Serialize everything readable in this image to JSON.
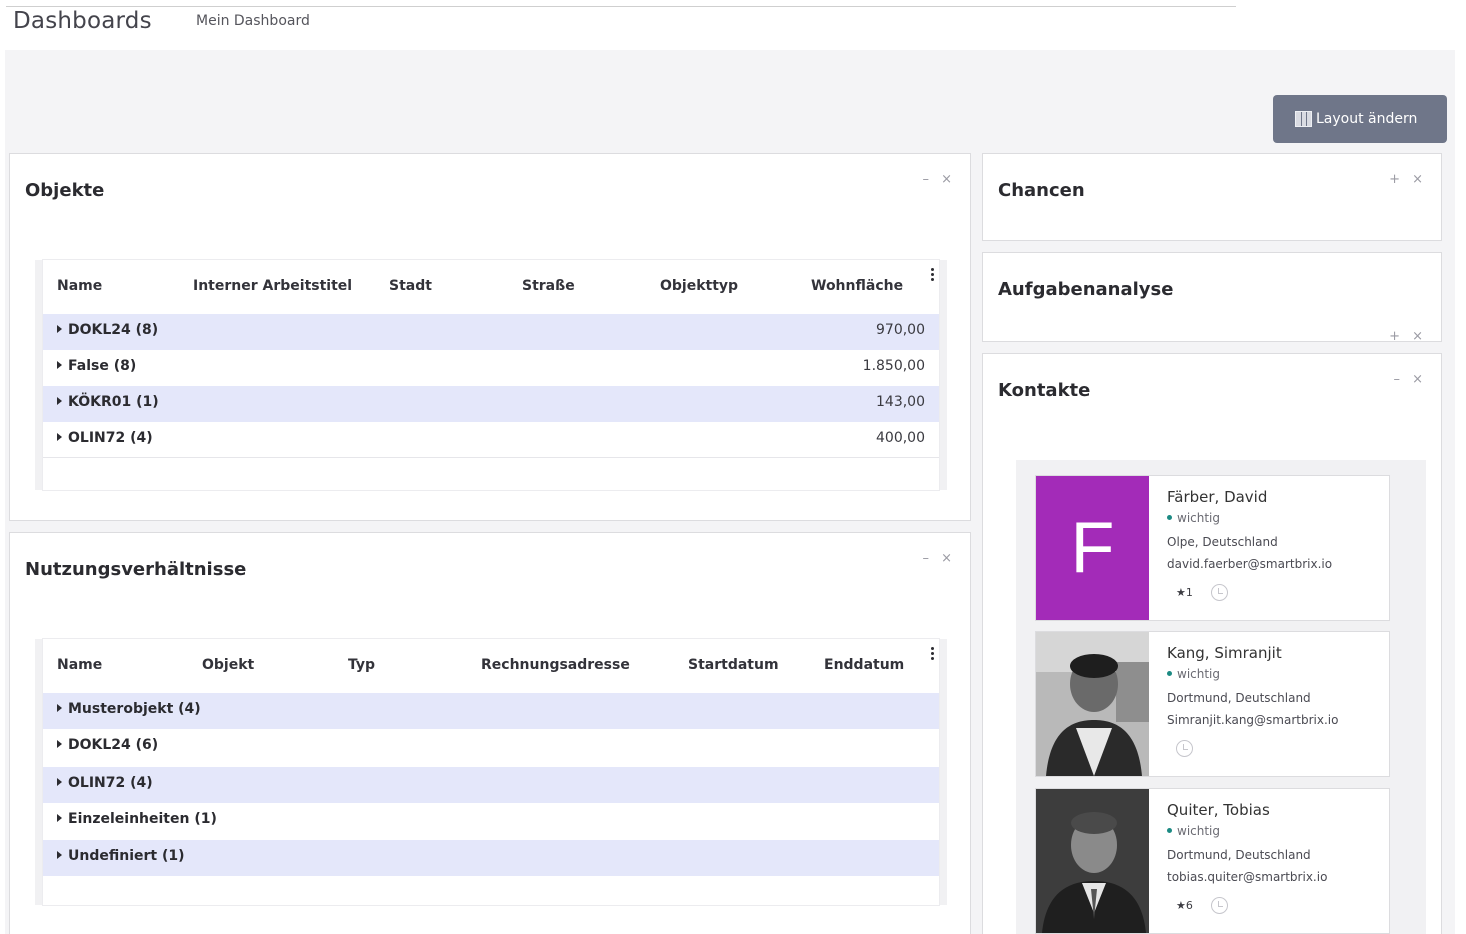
{
  "header": {
    "title": "Dashboards",
    "breadcrumb": "Mein Dashboard"
  },
  "toolbar": {
    "layout_button": "Layout ändern"
  },
  "objekte": {
    "title": "Objekte",
    "controls": "– ×",
    "columns": [
      "Name",
      "Interner Arbeitstitel",
      "Stadt",
      "Straße",
      "Objekttyp",
      "Wohnfläche"
    ],
    "rows": [
      {
        "label": "DOKL24 (8)",
        "value": "970,00"
      },
      {
        "label": "False (8)",
        "value": "1.850,00"
      },
      {
        "label": "KÖKR01 (1)",
        "value": "143,00"
      },
      {
        "label": "OLIN72 (4)",
        "value": "400,00"
      }
    ]
  },
  "nutzung": {
    "title": "Nutzungsverhältnisse",
    "controls": "– ×",
    "columns": [
      "Name",
      "Objekt",
      "Typ",
      "Rechnungsadresse",
      "Startdatum",
      "Enddatum"
    ],
    "rows": [
      {
        "label": "Musterobjekt (4)"
      },
      {
        "label": "DOKL24 (6)"
      },
      {
        "label": "OLIN72 (4)"
      },
      {
        "label": "Einzeleinheiten (1)"
      },
      {
        "label": "Undefiniert (1)"
      }
    ]
  },
  "chancen": {
    "title": "Chancen",
    "controls": "+ ×"
  },
  "aufgaben": {
    "title": "Aufgabenanalyse",
    "controls": "+ ×"
  },
  "kontakte": {
    "title": "Kontakte",
    "controls": "– ×",
    "items": [
      {
        "initial": "F",
        "name": "Färber, David",
        "tag": "wichtig",
        "location": "Olpe, Deutschland",
        "email": "david.faerber@smartbrix.io",
        "stars": "★1",
        "accent": "#a32bb8"
      },
      {
        "name": "Kang, Simranjit",
        "tag": "wichtig",
        "location": "Dortmund, Deutschland",
        "email": "Simranjit.kang@smartbrix.io",
        "stars": ""
      },
      {
        "name": "Quiter, Tobias",
        "tag": "wichtig",
        "location": "Dortmund, Deutschland",
        "email": "tobias.quiter@smartbrix.io",
        "stars": "★6"
      }
    ]
  }
}
